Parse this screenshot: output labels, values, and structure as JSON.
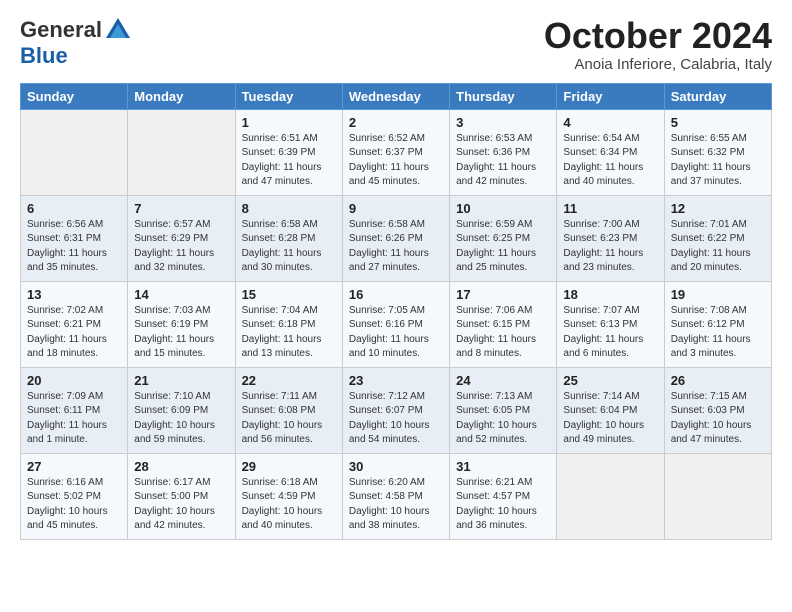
{
  "header": {
    "logo_general": "General",
    "logo_blue": "Blue",
    "month_title": "October 2024",
    "location": "Anoia Inferiore, Calabria, Italy"
  },
  "days_of_week": [
    "Sunday",
    "Monday",
    "Tuesday",
    "Wednesday",
    "Thursday",
    "Friday",
    "Saturday"
  ],
  "weeks": [
    [
      {
        "day": "",
        "info": ""
      },
      {
        "day": "",
        "info": ""
      },
      {
        "day": "1",
        "info": "Sunrise: 6:51 AM\nSunset: 6:39 PM\nDaylight: 11 hours and 47 minutes."
      },
      {
        "day": "2",
        "info": "Sunrise: 6:52 AM\nSunset: 6:37 PM\nDaylight: 11 hours and 45 minutes."
      },
      {
        "day": "3",
        "info": "Sunrise: 6:53 AM\nSunset: 6:36 PM\nDaylight: 11 hours and 42 minutes."
      },
      {
        "day": "4",
        "info": "Sunrise: 6:54 AM\nSunset: 6:34 PM\nDaylight: 11 hours and 40 minutes."
      },
      {
        "day": "5",
        "info": "Sunrise: 6:55 AM\nSunset: 6:32 PM\nDaylight: 11 hours and 37 minutes."
      }
    ],
    [
      {
        "day": "6",
        "info": "Sunrise: 6:56 AM\nSunset: 6:31 PM\nDaylight: 11 hours and 35 minutes."
      },
      {
        "day": "7",
        "info": "Sunrise: 6:57 AM\nSunset: 6:29 PM\nDaylight: 11 hours and 32 minutes."
      },
      {
        "day": "8",
        "info": "Sunrise: 6:58 AM\nSunset: 6:28 PM\nDaylight: 11 hours and 30 minutes."
      },
      {
        "day": "9",
        "info": "Sunrise: 6:58 AM\nSunset: 6:26 PM\nDaylight: 11 hours and 27 minutes."
      },
      {
        "day": "10",
        "info": "Sunrise: 6:59 AM\nSunset: 6:25 PM\nDaylight: 11 hours and 25 minutes."
      },
      {
        "day": "11",
        "info": "Sunrise: 7:00 AM\nSunset: 6:23 PM\nDaylight: 11 hours and 23 minutes."
      },
      {
        "day": "12",
        "info": "Sunrise: 7:01 AM\nSunset: 6:22 PM\nDaylight: 11 hours and 20 minutes."
      }
    ],
    [
      {
        "day": "13",
        "info": "Sunrise: 7:02 AM\nSunset: 6:21 PM\nDaylight: 11 hours and 18 minutes."
      },
      {
        "day": "14",
        "info": "Sunrise: 7:03 AM\nSunset: 6:19 PM\nDaylight: 11 hours and 15 minutes."
      },
      {
        "day": "15",
        "info": "Sunrise: 7:04 AM\nSunset: 6:18 PM\nDaylight: 11 hours and 13 minutes."
      },
      {
        "day": "16",
        "info": "Sunrise: 7:05 AM\nSunset: 6:16 PM\nDaylight: 11 hours and 10 minutes."
      },
      {
        "day": "17",
        "info": "Sunrise: 7:06 AM\nSunset: 6:15 PM\nDaylight: 11 hours and 8 minutes."
      },
      {
        "day": "18",
        "info": "Sunrise: 7:07 AM\nSunset: 6:13 PM\nDaylight: 11 hours and 6 minutes."
      },
      {
        "day": "19",
        "info": "Sunrise: 7:08 AM\nSunset: 6:12 PM\nDaylight: 11 hours and 3 minutes."
      }
    ],
    [
      {
        "day": "20",
        "info": "Sunrise: 7:09 AM\nSunset: 6:11 PM\nDaylight: 11 hours and 1 minute."
      },
      {
        "day": "21",
        "info": "Sunrise: 7:10 AM\nSunset: 6:09 PM\nDaylight: 10 hours and 59 minutes."
      },
      {
        "day": "22",
        "info": "Sunrise: 7:11 AM\nSunset: 6:08 PM\nDaylight: 10 hours and 56 minutes."
      },
      {
        "day": "23",
        "info": "Sunrise: 7:12 AM\nSunset: 6:07 PM\nDaylight: 10 hours and 54 minutes."
      },
      {
        "day": "24",
        "info": "Sunrise: 7:13 AM\nSunset: 6:05 PM\nDaylight: 10 hours and 52 minutes."
      },
      {
        "day": "25",
        "info": "Sunrise: 7:14 AM\nSunset: 6:04 PM\nDaylight: 10 hours and 49 minutes."
      },
      {
        "day": "26",
        "info": "Sunrise: 7:15 AM\nSunset: 6:03 PM\nDaylight: 10 hours and 47 minutes."
      }
    ],
    [
      {
        "day": "27",
        "info": "Sunrise: 6:16 AM\nSunset: 5:02 PM\nDaylight: 10 hours and 45 minutes."
      },
      {
        "day": "28",
        "info": "Sunrise: 6:17 AM\nSunset: 5:00 PM\nDaylight: 10 hours and 42 minutes."
      },
      {
        "day": "29",
        "info": "Sunrise: 6:18 AM\nSunset: 4:59 PM\nDaylight: 10 hours and 40 minutes."
      },
      {
        "day": "30",
        "info": "Sunrise: 6:20 AM\nSunset: 4:58 PM\nDaylight: 10 hours and 38 minutes."
      },
      {
        "day": "31",
        "info": "Sunrise: 6:21 AM\nSunset: 4:57 PM\nDaylight: 10 hours and 36 minutes."
      },
      {
        "day": "",
        "info": ""
      },
      {
        "day": "",
        "info": ""
      }
    ]
  ]
}
